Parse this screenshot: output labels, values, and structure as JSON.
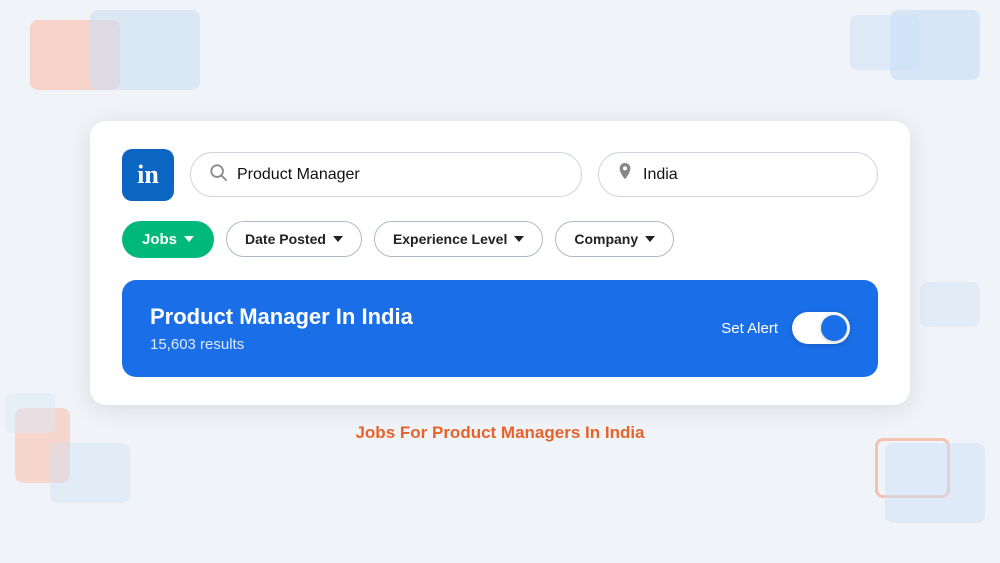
{
  "background_shapes": [
    "shape1",
    "shape2",
    "shape3",
    "shape4",
    "shape5",
    "shape6",
    "shape7",
    "shape8",
    "shape9",
    "shape10"
  ],
  "linkedin": {
    "logo_text": "in"
  },
  "search": {
    "job_placeholder": "Product Manager",
    "location_placeholder": "India"
  },
  "filters": {
    "jobs_label": "Jobs",
    "date_posted_label": "Date Posted",
    "experience_level_label": "Experience Level",
    "company_label": "Company"
  },
  "result": {
    "title": "Product Manager In India",
    "count": "15,603 results",
    "alert_label": "Set Alert"
  },
  "caption": {
    "text": "Jobs For Product Managers In India"
  }
}
